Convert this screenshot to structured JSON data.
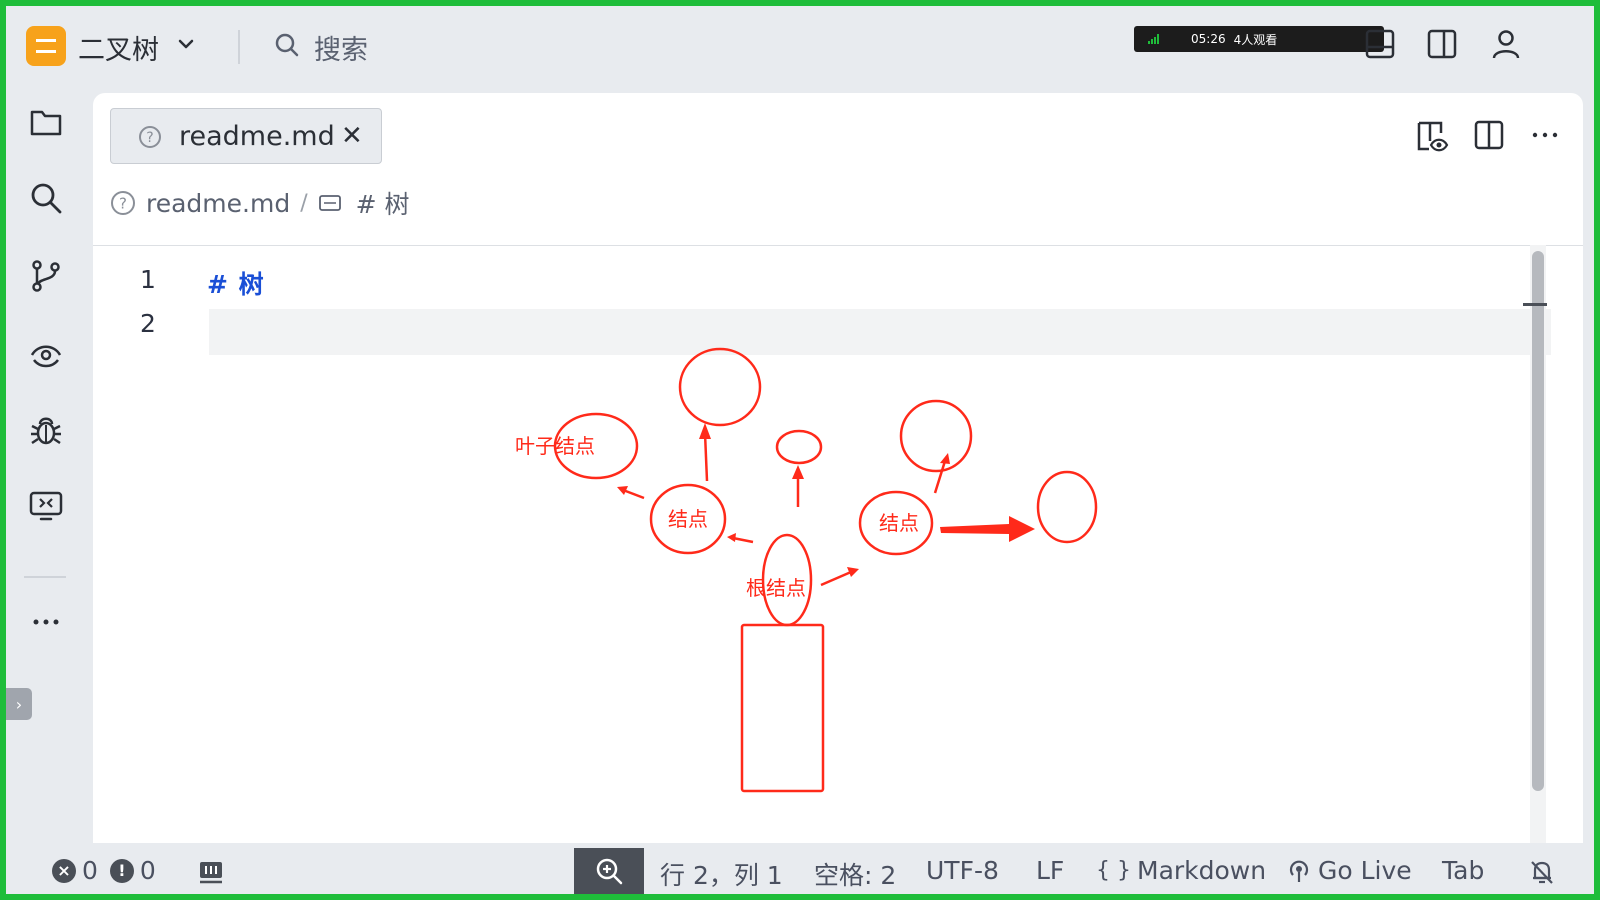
{
  "titlebar": {
    "project_name": "二叉树",
    "search_label": "搜索",
    "overlay_time": "05:26",
    "overlay_viewers": "4人观看"
  },
  "tab": {
    "label": "readme.md",
    "close": "✕"
  },
  "breadcrumb": {
    "file": "readme.md",
    "separator": "/",
    "heading": "# 树"
  },
  "editor": {
    "lines": [
      "1",
      "2"
    ],
    "line1_text": "# 树"
  },
  "annotations": {
    "leaf_node": "叶子结点",
    "node_left": "结点",
    "node_right": "结点",
    "root_node": "根结点",
    "color": "#ff2a1a"
  },
  "statusbar": {
    "errors": "0",
    "warnings": "0",
    "position": "行 2，列 1",
    "spaces": "空格: 2",
    "encoding": "UTF-8",
    "eol": "LF",
    "language": "Markdown",
    "go_live": "Go Live",
    "tab_mode": "Tab"
  },
  "colors": {
    "accent_orange": "#f7a21b",
    "frame_green": "#1fbd3a",
    "heading_blue": "#1a4fd6"
  }
}
